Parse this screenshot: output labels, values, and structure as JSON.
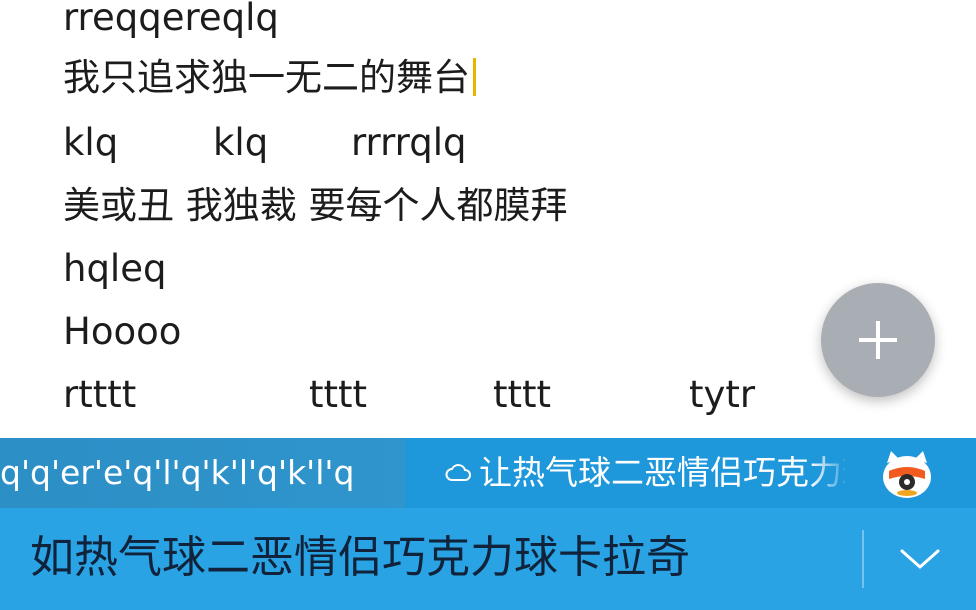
{
  "editor": {
    "lines": [
      {
        "text": "rreqqereqlq"
      },
      {
        "text": "我只追求独一无二的舞台"
      },
      {
        "segments": [
          "klq",
          "klq",
          "rrrrqlq"
        ]
      },
      {
        "text": "美或丑 我独裁 要每个人都膜拜"
      },
      {
        "text": "hqleq"
      },
      {
        "text": "Hoooo"
      },
      {
        "segments": [
          "rtttt",
          "tttt",
          "tttt",
          "tytr"
        ]
      }
    ],
    "caret_color": "#e7b400"
  },
  "fab": {
    "icon": "plus-icon",
    "color": "#a9adb4"
  },
  "ime": {
    "pinyin": "q'q'er'e'q'l'q'k'l'q'k'l'q",
    "cloud_icon": "cloud-icon",
    "cloud_candidate": "让热气球二恶情侣巧克力球卡拉奇",
    "mascot_icon": "ime-mascot-icon",
    "main_candidate": "如热气球二恶情侣巧克力球卡拉奇",
    "expand_icon": "chevron-down-icon",
    "colors": {
      "bar": "#2aa3e5",
      "top": "#1f97db"
    }
  }
}
